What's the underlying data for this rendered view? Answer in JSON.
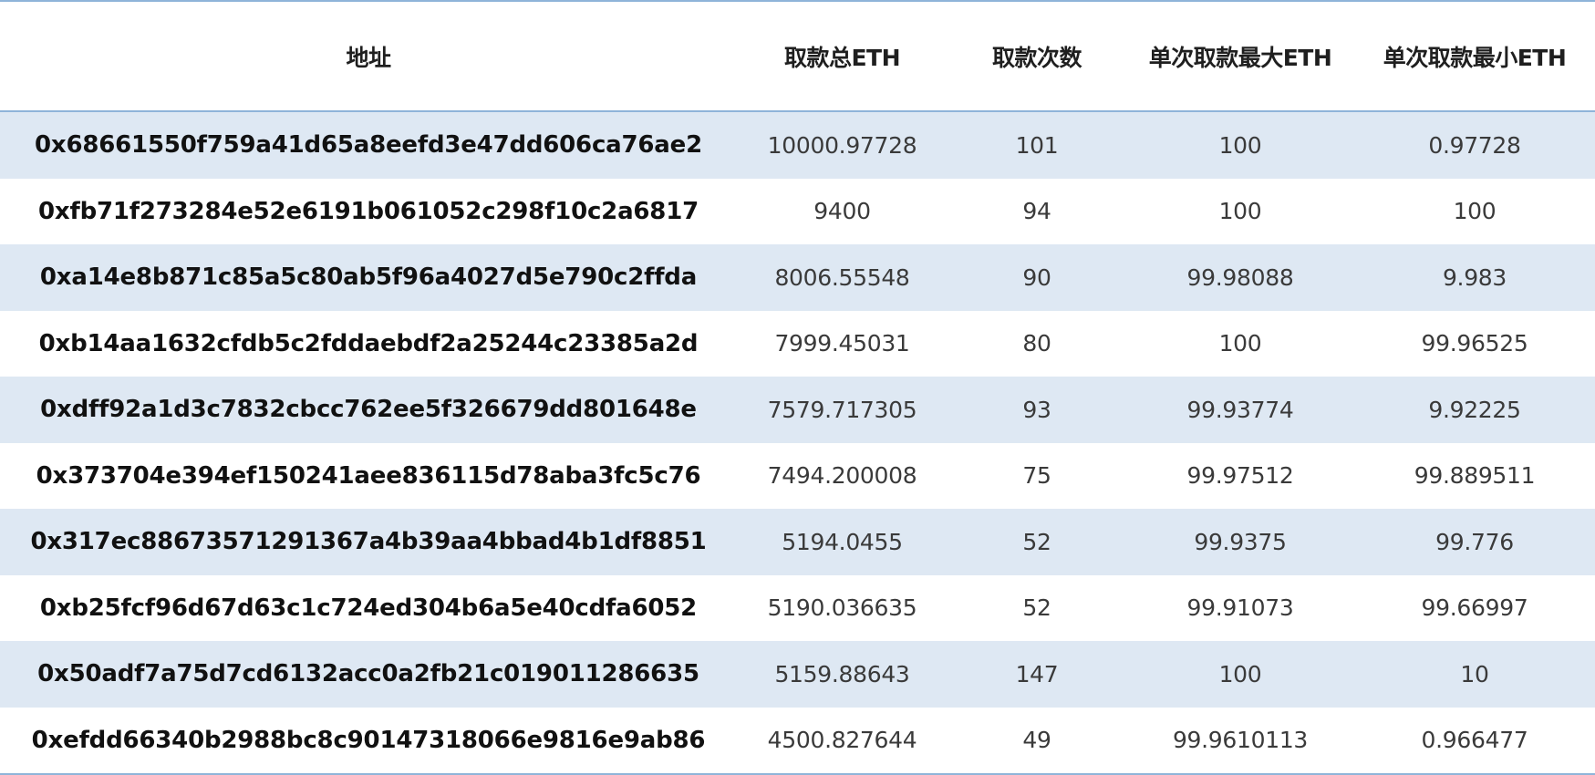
{
  "colors": {
    "row_shade": "#dee8f3",
    "rule": "#8fb4d9",
    "header_text": "#1f1f1f",
    "body_text": "#2a2a2a"
  },
  "table": {
    "headers": [
      "地址",
      "取款总ETH",
      "取款次数",
      "单次取款最大ETH",
      "单次取款最小ETH"
    ],
    "rows": [
      [
        "0x68661550f759a41d65a8eefd3e47dd606ca76ae2",
        "10000.97728",
        "101",
        "100",
        "0.97728"
      ],
      [
        "0xfb71f273284e52e6191b061052c298f10c2a6817",
        "9400",
        "94",
        "100",
        "100"
      ],
      [
        "0xa14e8b871c85a5c80ab5f96a4027d5e790c2ffda",
        "8006.55548",
        "90",
        "99.98088",
        "9.983"
      ],
      [
        "0xb14aa1632cfdb5c2fddaebdf2a25244c23385a2d",
        "7999.45031",
        "80",
        "100",
        "99.96525"
      ],
      [
        "0xdff92a1d3c7832cbcc762ee5f326679dd801648e",
        "7579.717305",
        "93",
        "99.93774",
        "9.92225"
      ],
      [
        "0x373704e394ef150241aee836115d78aba3fc5c76",
        "7494.200008",
        "75",
        "99.97512",
        "99.889511"
      ],
      [
        "0x317ec88673571291367a4b39aa4bbad4b1df8851",
        "5194.0455",
        "52",
        "99.9375",
        "99.776"
      ],
      [
        "0xb25fcf96d67d63c1c724ed304b6a5e40cdfa6052",
        "5190.036635",
        "52",
        "99.91073",
        "99.66997"
      ],
      [
        "0x50adf7a75d7cd6132acc0a2fb21c019011286635",
        "5159.88643",
        "147",
        "100",
        "10"
      ],
      [
        "0xefdd66340b2988bc8c90147318066e9816e9ab86",
        "4500.827644",
        "49",
        "99.9610113",
        "0.966477"
      ]
    ]
  }
}
